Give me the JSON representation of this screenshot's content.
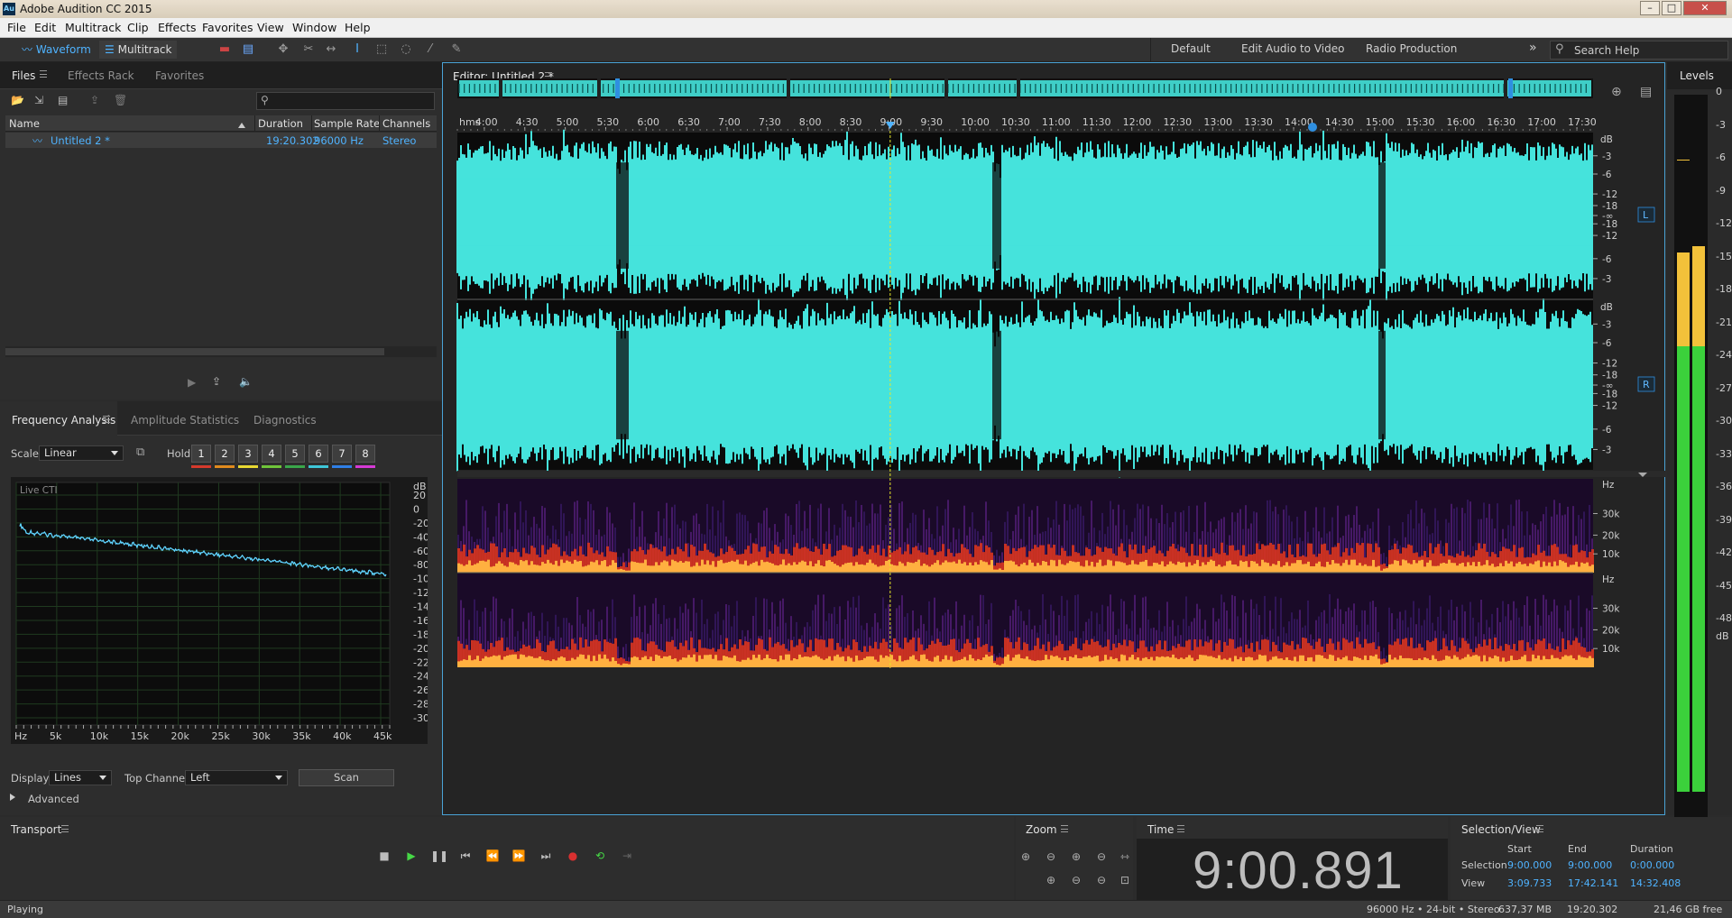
{
  "titlebar": {
    "title": "Adobe Audition CC 2015",
    "logo": "Au"
  },
  "menu": [
    "File",
    "Edit",
    "Multitrack",
    "Clip",
    "Effects",
    "Favorites",
    "View",
    "Window",
    "Help"
  ],
  "toolbar": {
    "waveform": "Waveform",
    "multitrack": "Multitrack",
    "workspaces": [
      "Default",
      "Edit Audio to Video",
      "Radio Production"
    ],
    "search_placeholder": "Search Help",
    "more": "»"
  },
  "files_panel": {
    "tabs": [
      "Files",
      "Effects Rack",
      "Favorites"
    ],
    "search_icon": "⚲",
    "columns": [
      "Name",
      "Duration",
      "Sample Rate",
      "Channels"
    ],
    "rows": [
      {
        "name": "Untitled 2 *",
        "duration": "19:20.302",
        "rate": "96000 Hz",
        "channels": "Stereo"
      }
    ]
  },
  "analysis_panel": {
    "tabs": [
      "Frequency Analysis",
      "Amplitude Statistics",
      "Diagnostics"
    ],
    "scale_label": "Scale:",
    "scale_value": "Linear",
    "hold_label": "Hold:",
    "holds": [
      "1",
      "2",
      "3",
      "4",
      "5",
      "6",
      "7",
      "8"
    ],
    "hold_colors": [
      "#d63a2c",
      "#e08a1e",
      "#e8d832",
      "#6fc43a",
      "#3aa64a",
      "#3ec6d8",
      "#2f7fe6",
      "#d63ad6"
    ],
    "plot_label": "Live CTI",
    "db_unit": "dB",
    "db_ticks": [
      "20",
      "0",
      "-20",
      "-40",
      "-60",
      "-80",
      "-100",
      "-120",
      "-140",
      "-160",
      "-180",
      "-200",
      "-220",
      "-240",
      "-260",
      "-280",
      "-300"
    ],
    "hz_ticks": [
      "Hz",
      "5k",
      "10k",
      "15k",
      "20k",
      "25k",
      "30k",
      "35k",
      "40k",
      "45k"
    ],
    "display_label": "Display:",
    "display_value": "Lines",
    "top_channel_label": "Top Channel:",
    "top_channel_value": "Left",
    "scan": "Scan",
    "advanced": "Advanced"
  },
  "editor": {
    "title": "Editor: Untitled 2 *",
    "time_unit": "hms",
    "time_ticks": [
      "4:00",
      "4:30",
      "5:00",
      "5:30",
      "6:00",
      "6:30",
      "7:00",
      "7:30",
      "8:00",
      "8:30",
      "9:00",
      "9:30",
      "10:00",
      "10:30",
      "11:00",
      "11:30",
      "12:00",
      "12:30",
      "13:00",
      "13:30",
      "14:00",
      "14:30",
      "15:00",
      "15:30",
      "16:00",
      "16:30",
      "17:00",
      "17:30"
    ],
    "db_unit": "dB",
    "db_ticks_L": [
      "-3",
      "-6",
      "-12",
      "-18",
      "-∞",
      "-18",
      "-12",
      "-6",
      "-3"
    ],
    "db_ticks_R": [
      "-3",
      "-6",
      "-12",
      "-18",
      "-∞",
      "-18",
      "-12",
      "-6",
      "-3"
    ],
    "channel_L": "L",
    "channel_R": "R",
    "hz_unit": "Hz",
    "hz_ticks": [
      "30k",
      "20k",
      "10k"
    ],
    "waveform_color": "#45e3dc"
  },
  "levels": {
    "title": "Levels",
    "ticks": [
      "0",
      "-3",
      "-6",
      "-9",
      "-12",
      "-15",
      "-18",
      "-21",
      "-24",
      "-27",
      "-30",
      "-33",
      "-36",
      "-39",
      "-42",
      "-45",
      "-48"
    ],
    "unit": "dB"
  },
  "transport": {
    "title": "Transport"
  },
  "zoom": {
    "title": "Zoom"
  },
  "time": {
    "title": "Time",
    "display": "9:00.891"
  },
  "selection_view": {
    "title": "Selection/View",
    "headers": [
      "Start",
      "End",
      "Duration"
    ],
    "rows": [
      {
        "label": "Selection",
        "start": "9:00.000",
        "end": "9:00.000",
        "duration": "0:00.000"
      },
      {
        "label": "View",
        "start": "3:09.733",
        "end": "17:42.141",
        "duration": "14:32.408"
      }
    ]
  },
  "status": {
    "state": "Playing",
    "format": "96000 Hz • 24-bit • Stereo",
    "size": "637,37 MB",
    "duration": "19:20.302",
    "free": "21,46 GB free"
  }
}
